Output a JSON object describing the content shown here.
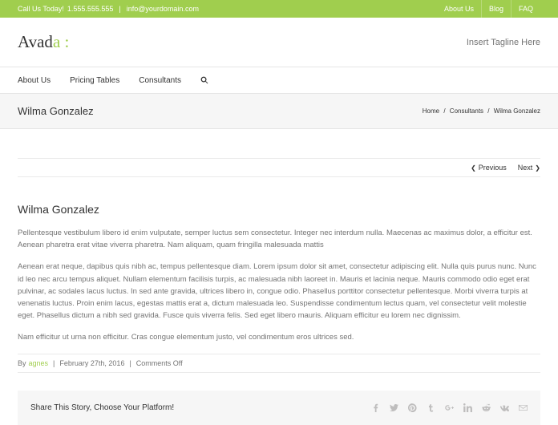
{
  "topbar": {
    "call_prefix": "Call Us Today!",
    "phone": "1.555.555.555",
    "email": "info@yourdomain.com",
    "menu": [
      "About Us",
      "Blog",
      "FAQ"
    ]
  },
  "header": {
    "logo_main": "Avad",
    "logo_accent": "a :",
    "tagline": "Insert Tagline Here"
  },
  "nav": {
    "items": [
      "About Us",
      "Pricing Tables",
      "Consultants"
    ]
  },
  "titlebar": {
    "title": "Wilma Gonzalez",
    "breadcrumb": [
      "Home",
      "Consultants",
      "Wilma Gonzalez"
    ]
  },
  "pager": {
    "previous": "Previous",
    "next": "Next"
  },
  "post": {
    "title": "Wilma Gonzalez",
    "p1": "Pellentesque vestibulum libero id enim vulputate, semper luctus sem consectetur. Integer nec interdum nulla. Maecenas ac maximus dolor, a efficitur est. Aenean pharetra erat vitae viverra pharetra. Nam aliquam, quam fringilla malesuada mattis",
    "p2": "Aenean erat neque, dapibus quis nibh ac, tempus pellentesque diam. Lorem ipsum dolor sit amet, consectetur adipiscing elit. Nulla quis purus nunc. Nunc id leo nec arcu tempus aliquet. Nullam elementum facilisis turpis, ac malesuada nibh laoreet in. Mauris et lacinia neque. Mauris commodo odio eget erat pulvinar, ac sodales lacus luctus. In sed ante gravida, ultrices libero in, congue odio. Phasellus porttitor consectetur pellentesque. Morbi viverra turpis at venenatis luctus. Proin enim lacus, egestas mattis erat a, dictum malesuada leo. Suspendisse condimentum lectus quam, vel consectetur velit molestie eget. Phasellus dictum a nibh sed gravida. Fusce quis viverra felis. Sed eget libero mauris. Aliquam efficitur eu lorem nec dignissim.",
    "p3": "Nam efficitur ut urna non efficitur. Cras congue elementum justo, vel condimentum eros ultrices sed."
  },
  "meta": {
    "by": "By",
    "author": "agnes",
    "date": "February 27th, 2016",
    "comments": "Comments Off"
  },
  "share": {
    "text": "Share This Story, Choose Your Platform!"
  }
}
